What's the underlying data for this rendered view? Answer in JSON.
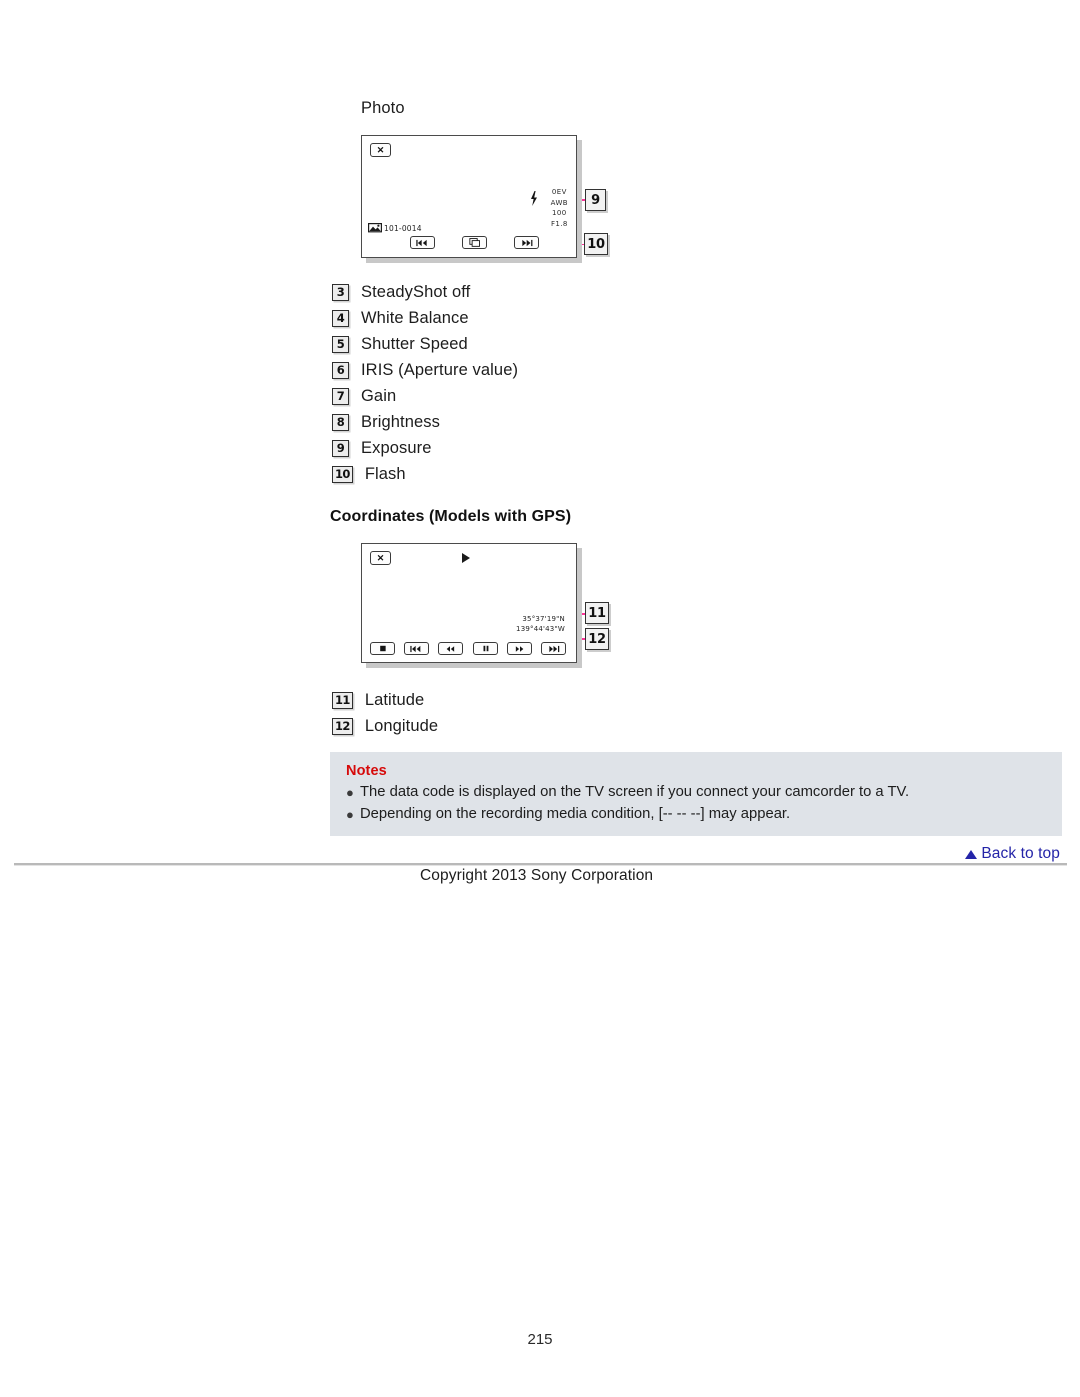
{
  "page": {
    "number": "215",
    "copyright": "Copyright 2013 Sony Corporation",
    "back_to_top": "Back to top",
    "link_color": "#2424a8",
    "notes_bg": "#dfe3e8",
    "notes_title_color": "#d60a0a",
    "leader_color": "#ff3399"
  },
  "photo_section": {
    "label": "Photo",
    "screen": {
      "close_button": "✕",
      "file_icon_name": "photo-file-icon",
      "file_number": "101-0014",
      "flash_icon_name": "flash-icon",
      "info_lines": [
        "0EV",
        "AWB",
        "100",
        "F1.8"
      ],
      "buttons": [
        {
          "name": "previous-button",
          "glyph": "◄◄|"
        },
        {
          "name": "photo-playback-button",
          "glyph": "⧉"
        },
        {
          "name": "next-button",
          "glyph": "|►►"
        }
      ]
    },
    "callouts": [
      {
        "number": "9",
        "target": "0EV"
      },
      {
        "number": "10",
        "target": "flash"
      }
    ]
  },
  "items": [
    {
      "number": "3",
      "label": "SteadyShot off"
    },
    {
      "number": "4",
      "label": "White Balance"
    },
    {
      "number": "5",
      "label": "Shutter Speed"
    },
    {
      "number": "6",
      "label": "IRIS (Aperture value)"
    },
    {
      "number": "7",
      "label": "Gain"
    },
    {
      "number": "8",
      "label": "Brightness"
    },
    {
      "number": "9",
      "label": "Exposure"
    },
    {
      "number": "10",
      "label": "Flash"
    }
  ],
  "coordinates_section": {
    "heading": "Coordinates (Models with GPS)",
    "screen": {
      "close_button": "✕",
      "play_icon_name": "play-icon",
      "latitude": "35°37'19\"N",
      "longitude": "139°44'43\"W",
      "buttons": [
        {
          "name": "stop-button",
          "glyph": "■"
        },
        {
          "name": "previous-button",
          "glyph": "|◄◄"
        },
        {
          "name": "rewind-button",
          "glyph": "◄◄"
        },
        {
          "name": "pause-button",
          "glyph": "❙❙"
        },
        {
          "name": "fast-forward-button",
          "glyph": "►►"
        },
        {
          "name": "next-button",
          "glyph": "►►|"
        }
      ]
    },
    "callouts": [
      {
        "number": "11",
        "target": "latitude"
      },
      {
        "number": "12",
        "target": "longitude"
      }
    ],
    "items": [
      {
        "number": "11",
        "label": "Latitude"
      },
      {
        "number": "12",
        "label": "Longitude"
      }
    ]
  },
  "notes": {
    "title": "Notes",
    "bullet": "●",
    "lines": [
      "The data code is displayed on the TV screen if you connect your camcorder to a TV.",
      "Depending on the recording media condition, [-- -- --] may appear."
    ]
  }
}
